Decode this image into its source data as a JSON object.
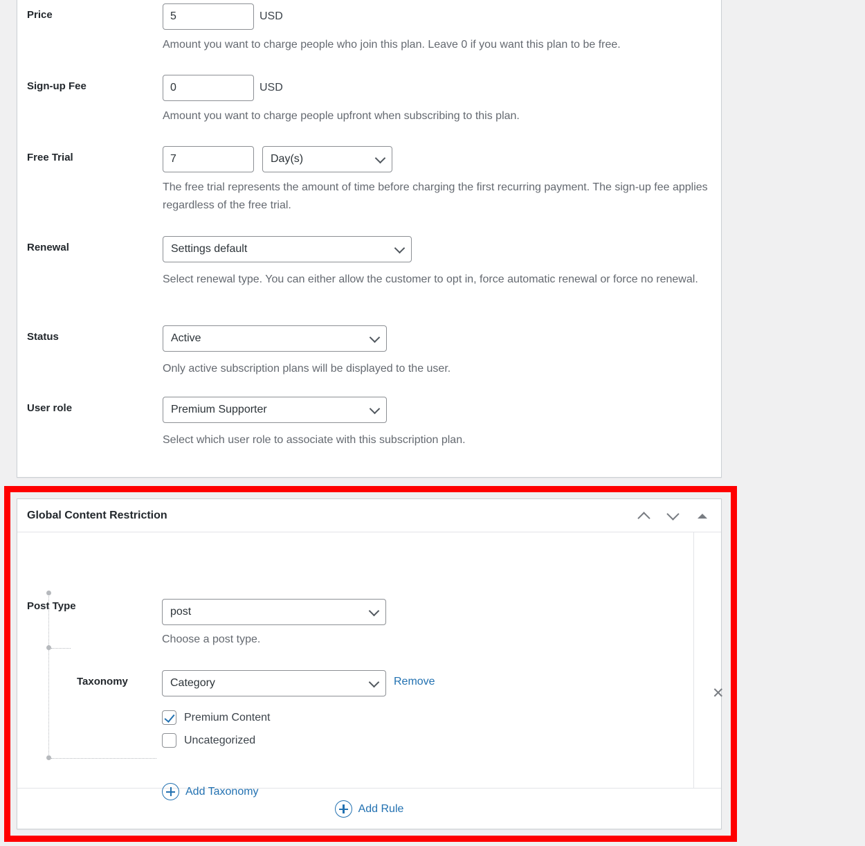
{
  "plan_settings": {
    "fields": [
      {
        "label": "Price",
        "value": "5",
        "unit": "USD",
        "help": "Amount you want to charge people who join this plan. Leave 0 if you want this plan to be free."
      },
      {
        "label": "Sign-up Fee",
        "value": "0",
        "unit": "USD",
        "help": "Amount you want to charge people upfront when subscribing to this plan."
      },
      {
        "label": "Free Trial",
        "value": "7",
        "period": "Day(s)",
        "help": "The free trial represents the amount of time before charging the first recurring payment. The sign-up fee applies regardless of the free trial."
      },
      {
        "label": "Renewal",
        "value": "Settings default",
        "help": "Select renewal type. You can either allow the customer to opt in, force automatic renewal or force no renewal."
      },
      {
        "label": "Status",
        "value": "Active",
        "help": "Only active subscription plans will be displayed to the user."
      },
      {
        "label": "User role",
        "value": "Premium Supporter",
        "help": "Select which user role to associate with this subscription plan."
      }
    ]
  },
  "restriction_panel": {
    "title": "Global Content Restriction",
    "header_icons": {
      "move_up": "chevron-up-icon",
      "move_down": "chevron-down-icon",
      "collapse": "triangle-up-icon"
    },
    "rule": {
      "post_type": {
        "label": "Post Type",
        "value": "post",
        "help": "Choose a post type."
      },
      "taxonomy": {
        "label": "Taxonomy",
        "value": "Category",
        "remove_label": "Remove",
        "terms": [
          {
            "label": "Premium Content",
            "checked": true
          },
          {
            "label": "Uncategorized",
            "checked": false
          }
        ],
        "add_label": "Add Taxonomy"
      },
      "remove_rule_icon": "close-icon"
    },
    "add_rule_label": "Add Rule"
  },
  "colors": {
    "highlight": "#ff0000",
    "link": "#2271b1",
    "panel_border": "#ccd0d4",
    "page_background": "#f0f0f1"
  }
}
